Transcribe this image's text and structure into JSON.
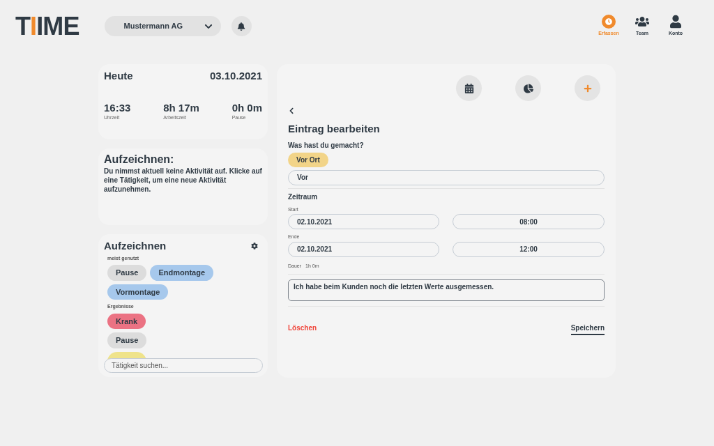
{
  "logo": [
    {
      "text": "T",
      "accent": false
    },
    {
      "text": "I",
      "accent": true
    },
    {
      "text": "IME",
      "accent": false
    }
  ],
  "company_select": {
    "value": "Mustermann AG"
  },
  "nav": [
    {
      "label": "Erfassen",
      "kind": "clock",
      "selected": true
    },
    {
      "label": "Team",
      "kind": "team",
      "selected": false
    },
    {
      "label": "Konto",
      "kind": "user",
      "selected": false
    }
  ],
  "today": {
    "title": "Heute",
    "date": "03.10.2021",
    "stats": [
      {
        "value": "16:33",
        "label": "Uhrzeit"
      },
      {
        "value": "8h 17m",
        "label": "Arbeitszeit"
      },
      {
        "value": "0h 0m",
        "label": "Pause"
      }
    ]
  },
  "recording": {
    "title": "Aufzeichnen:",
    "text": "Du nimmst aktuell keine Aktivität auf. Klicke auf eine Tätigkeit, um eine neue Aktivität aufzunehmen."
  },
  "activities": {
    "title": "Aufzeichnen",
    "sections": [
      {
        "heading": "meist genutzt",
        "chips": [
          {
            "label": "Pause",
            "color": "#dcdcdc"
          },
          {
            "label": "Endmontage",
            "color": "#a6c8ec"
          },
          {
            "label": "Vormontage",
            "color": "#a6c8ec"
          }
        ]
      },
      {
        "heading": "Ergebnisse",
        "chips": [
          {
            "label": "Krank",
            "color": "#eb7283"
          },
          {
            "label": "Pause",
            "color": "#dcdcdc"
          },
          {
            "color": "#efe38a"
          }
        ]
      }
    ],
    "search": {
      "placeholder": "Tätigkeit suchen..."
    }
  },
  "toolbar": [
    {
      "kind": "calendar"
    },
    {
      "kind": "chart"
    },
    {
      "kind": "add"
    }
  ],
  "form": {
    "title": "Eintrag bearbeiten",
    "question": "Was hast du gemacht?",
    "selected_chip": {
      "label": "Vor Ort",
      "color": "#f2d488"
    },
    "activity_value": "Vor",
    "period_label": "Zeitraum",
    "start": {
      "label": "Start",
      "date": "02.10.2021",
      "time": "08:00"
    },
    "end": {
      "label": "Ende",
      "date": "02.10.2021",
      "time": "12:00"
    },
    "duration_label": "Dauer",
    "duration": "1h 0m",
    "note": "Ich habe beim Kunden noch die letzten Werte ausgemessen.",
    "delete": "Löschen",
    "save": "Speichern"
  }
}
